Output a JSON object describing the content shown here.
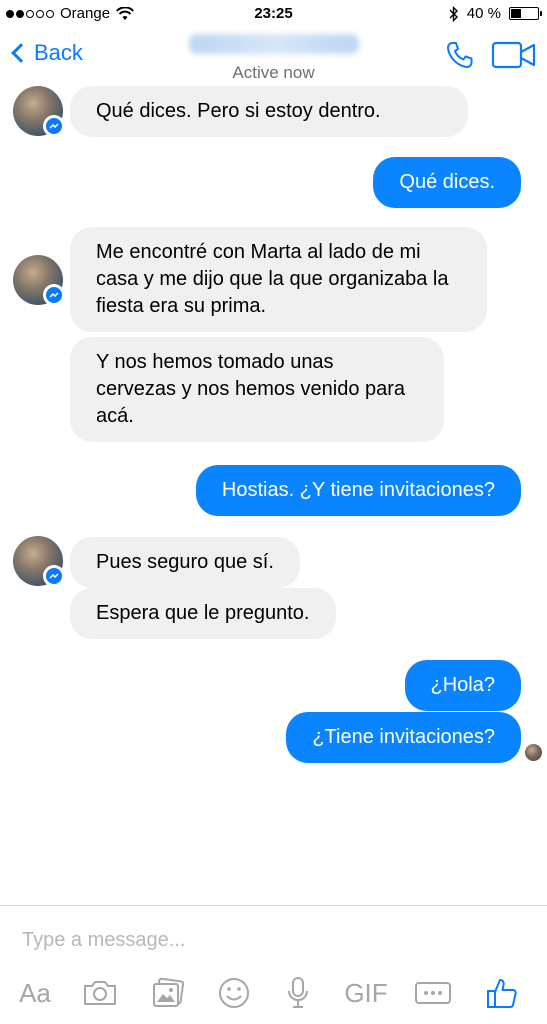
{
  "status_bar": {
    "carrier": "Orange",
    "time": "23:25",
    "battery": "40 %",
    "battery_level": 0.4
  },
  "nav": {
    "back_label": "Back",
    "subtitle": "Active now"
  },
  "messages": [
    {
      "id": "m1",
      "side": "in",
      "text": "Qué dices. Pero si estoy dentro."
    },
    {
      "id": "m2",
      "side": "out",
      "text": "Qué dices."
    },
    {
      "id": "m3",
      "side": "in",
      "text": "Me encontré con Marta al lado de mi casa y me dijo que la que organizaba la fiesta era su prima."
    },
    {
      "id": "m4",
      "side": "in",
      "text": "Y nos hemos tomado unas cervezas y nos hemos venido para acá."
    },
    {
      "id": "m5",
      "side": "out",
      "text": "Hostias. ¿Y tiene invitaciones?"
    },
    {
      "id": "m6",
      "side": "in",
      "text": "Pues seguro que sí."
    },
    {
      "id": "m7",
      "side": "in",
      "text": "Espera que le pregunto."
    },
    {
      "id": "m8",
      "side": "out",
      "text": "¿Hola?"
    },
    {
      "id": "m9",
      "side": "out",
      "text": "¿Tiene invitaciones?"
    }
  ],
  "composer": {
    "placeholder": "Type a message..."
  },
  "toolbar": {
    "aa_label": "Aa",
    "gif_label": "GIF",
    "icons": [
      "camera-icon",
      "gallery-icon",
      "emoji-icon",
      "microphone-icon",
      "more-icon",
      "thumbs-up-icon"
    ]
  },
  "colors": {
    "accent": "#0a7aff",
    "outgoing_bubble": "#0a84ff",
    "incoming_bubble": "#f0f0f0",
    "toolbar_icon": "#a6a6a6"
  }
}
